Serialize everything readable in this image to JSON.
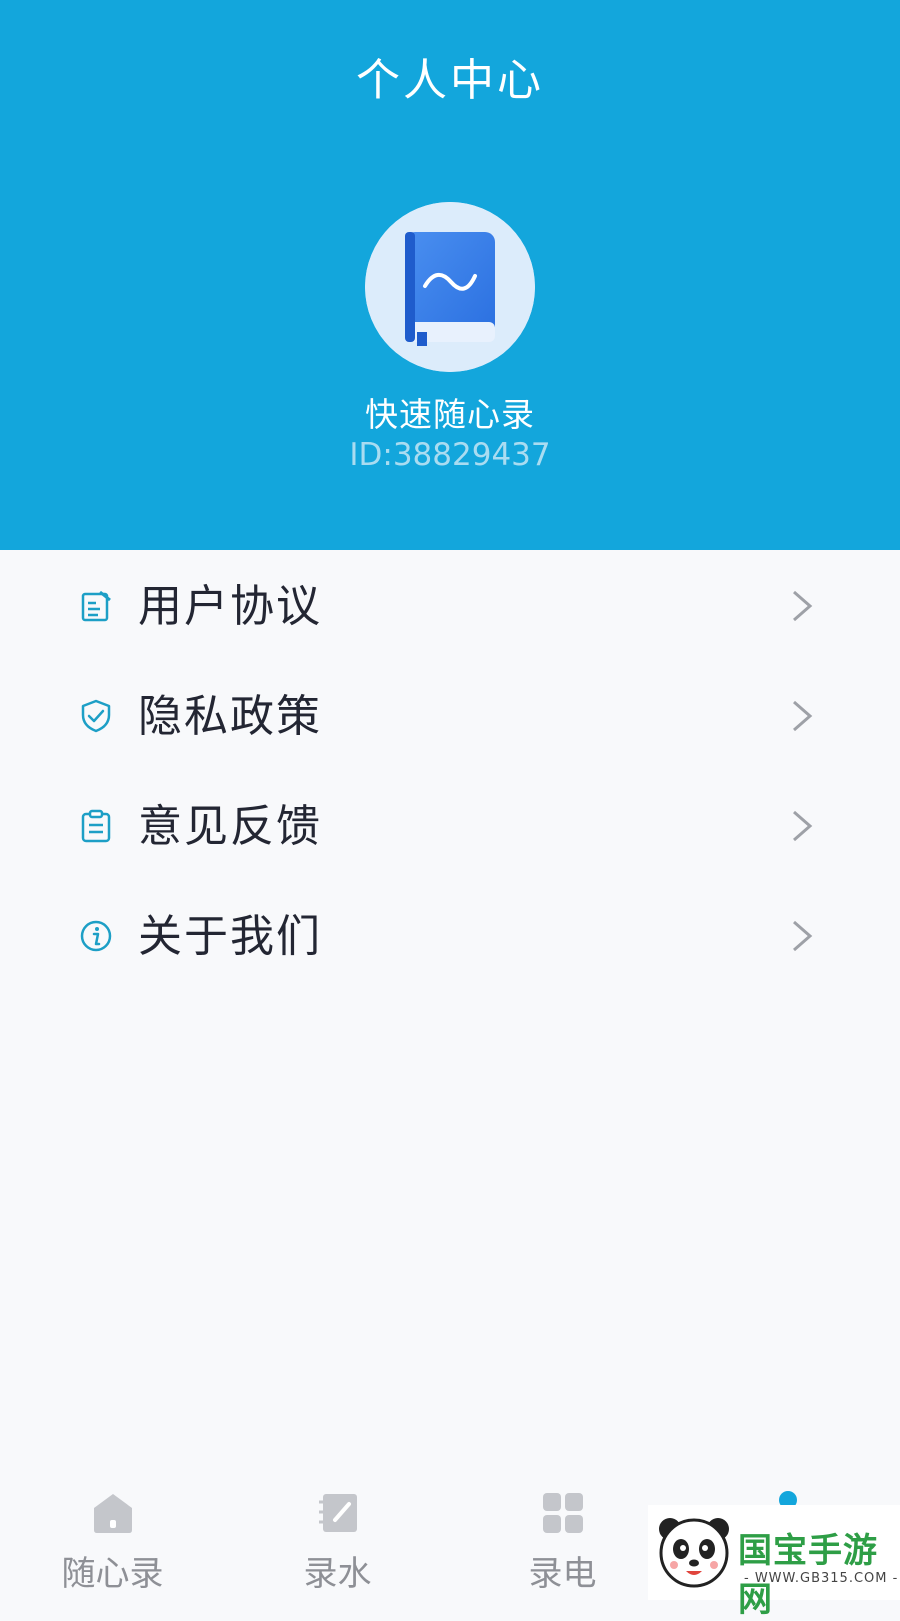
{
  "header": {
    "title": "个人中心",
    "app_name": "快速随心录",
    "user_id": "ID:38829437",
    "avatar_icon": "book-icon"
  },
  "menu": [
    {
      "label": "用户协议",
      "icon": "edit-document-icon"
    },
    {
      "label": "隐私政策",
      "icon": "shield-check-icon"
    },
    {
      "label": "意见反馈",
      "icon": "clipboard-icon"
    },
    {
      "label": "关于我们",
      "icon": "info-icon"
    }
  ],
  "tabbar": {
    "tabs": [
      {
        "label": "随心录",
        "icon": "home-icon"
      },
      {
        "label": "录水",
        "icon": "notebook-pen-icon"
      },
      {
        "label": "录电",
        "icon": "grid-icon"
      },
      {
        "label": "",
        "icon": "person-icon"
      }
    ]
  },
  "watermark": {
    "text": "国宝手游网",
    "sub": "- WWW.GB315.COM -"
  },
  "colors": {
    "header_bg": "#13a6dc",
    "accent": "#13a6dc",
    "icon_teal": "#1d9fc6"
  }
}
